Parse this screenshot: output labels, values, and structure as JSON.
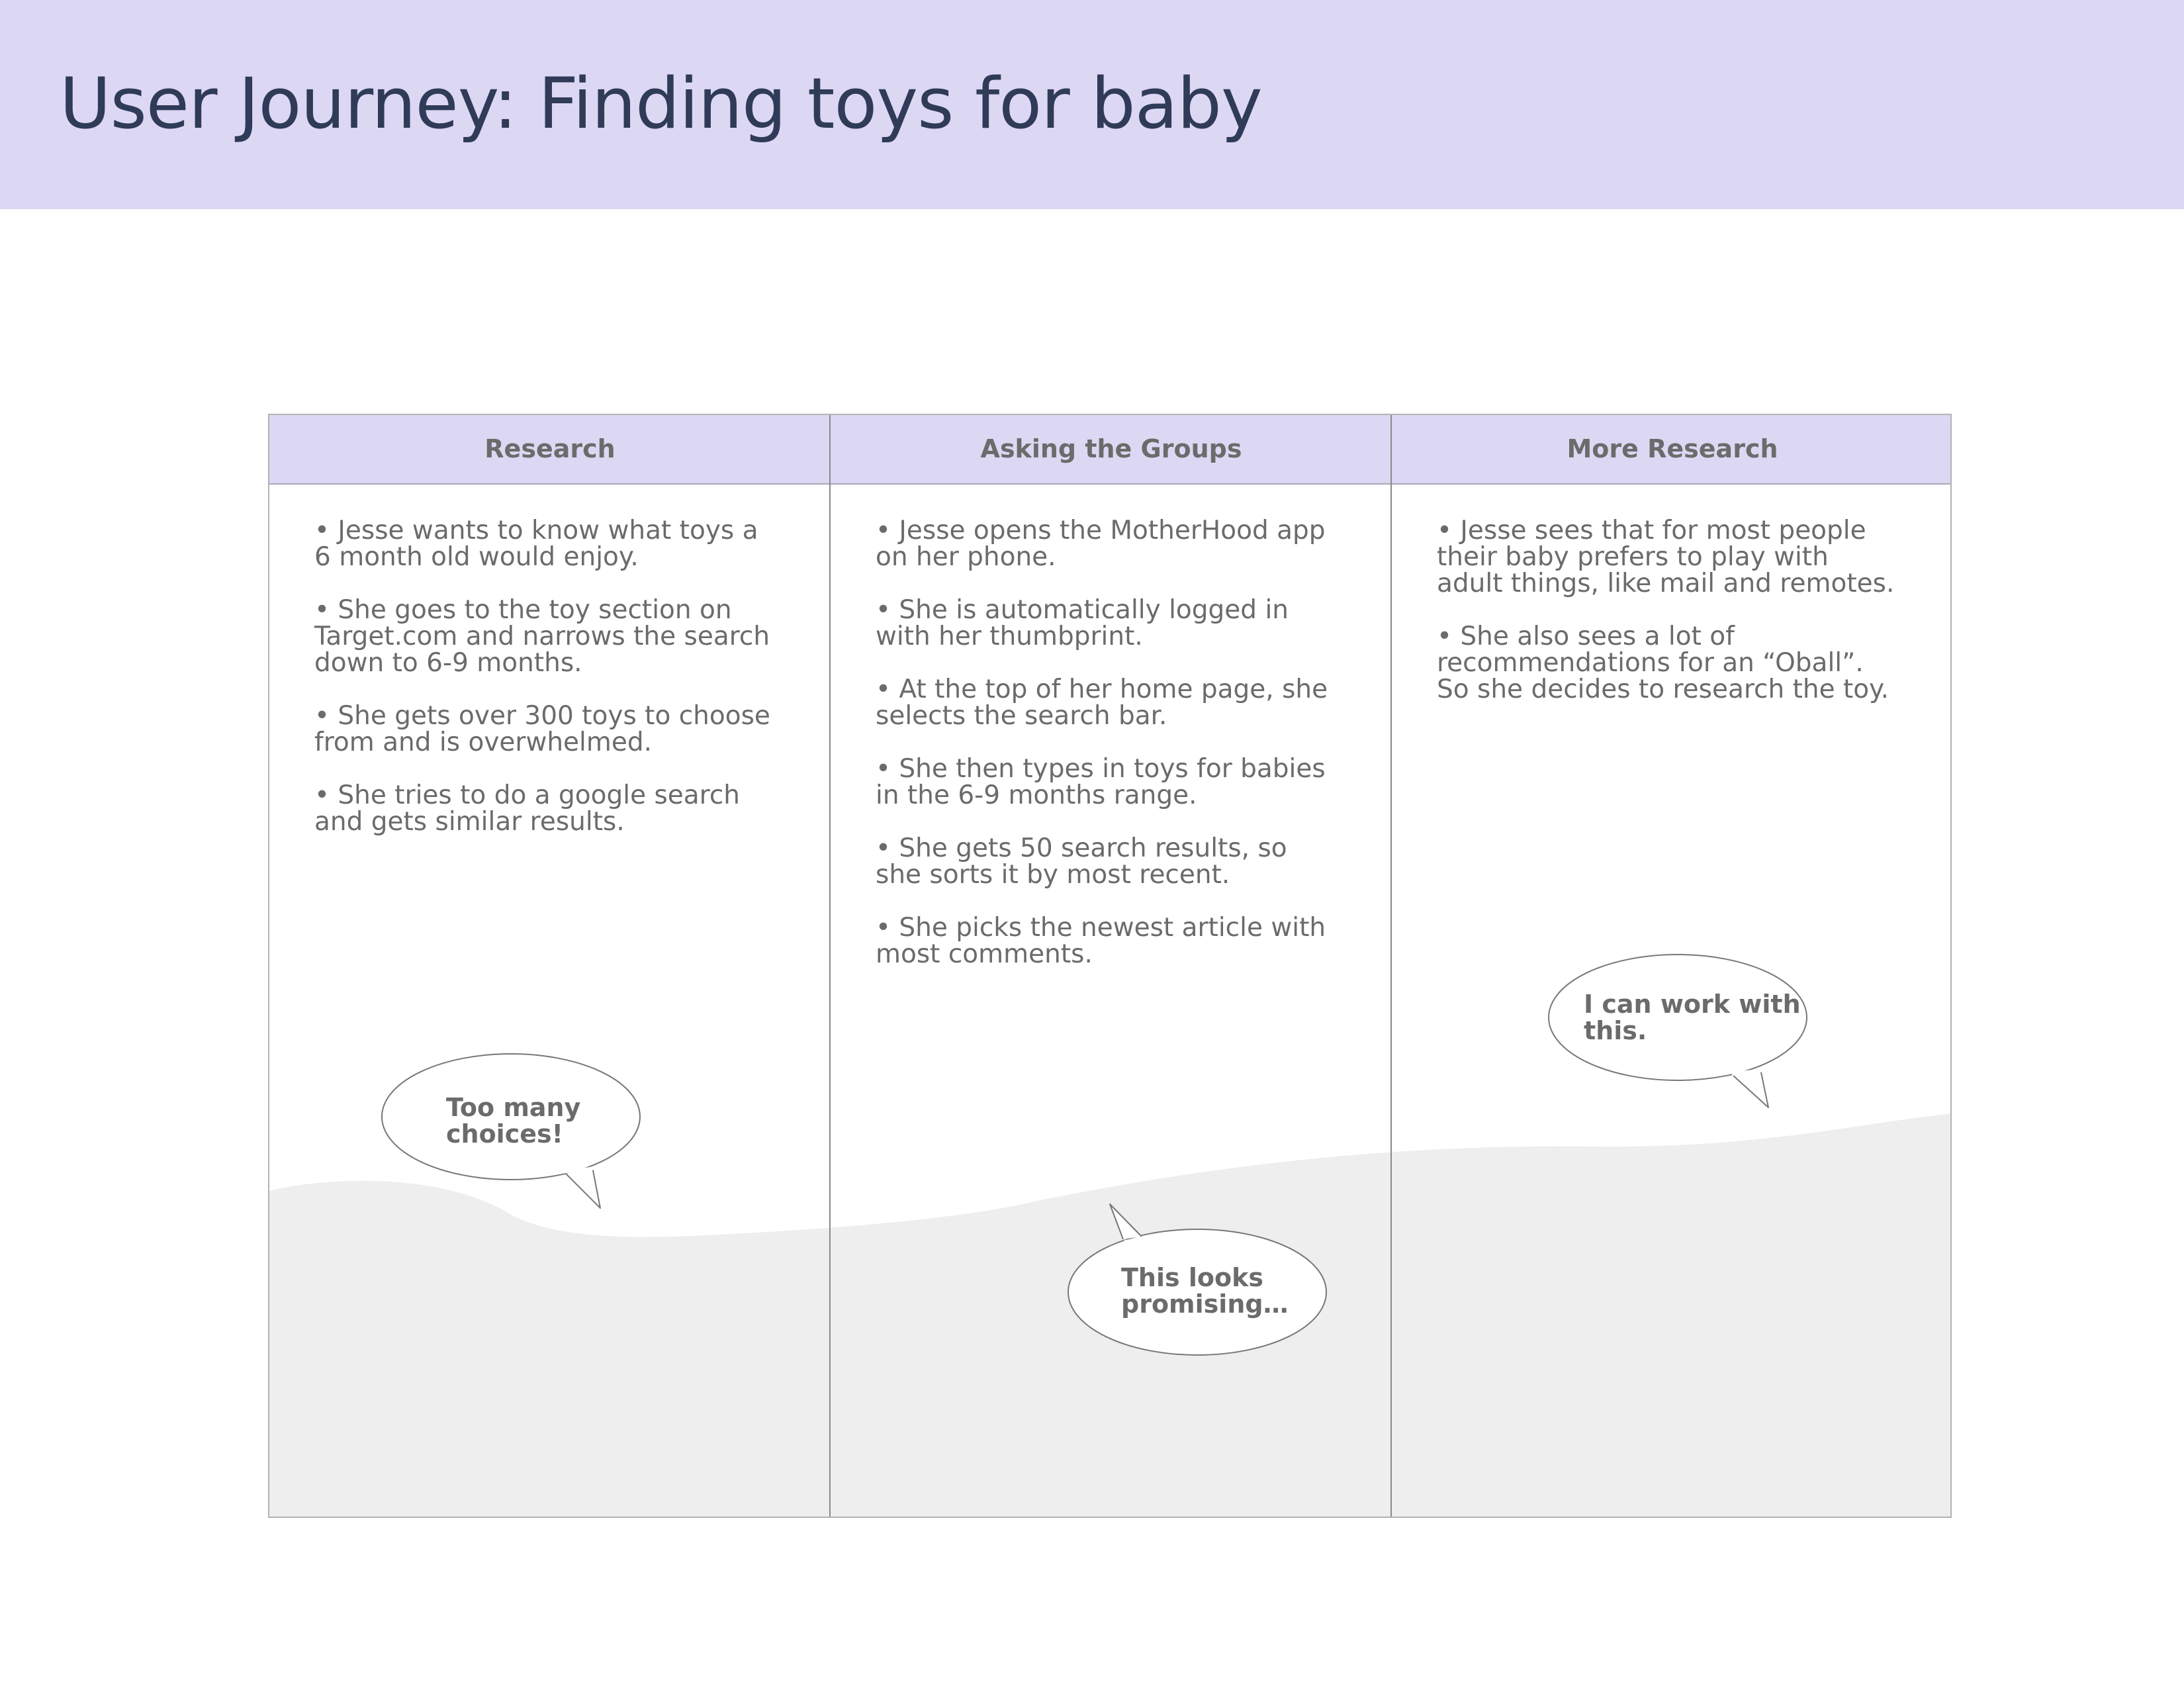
{
  "title": "User Journey: Finding toys for baby",
  "columns": [
    {
      "header": "Research",
      "bullets": [
        "Jesse wants to know what toys a 6 month old would enjoy.",
        "She goes to the toy section on Target.com and narrows the search down to 6-9 months.",
        "She gets over 300 toys to choose from and is overwhelmed.",
        "She tries to do a google search and gets similar results."
      ],
      "bubble": "Too many choices!"
    },
    {
      "header": "Asking the Groups",
      "bullets": [
        "Jesse opens the MotherHood app on her phone.",
        "She is automatically logged in with her thumbprint.",
        "At the top of her home page, she selects the search bar.",
        "She then types in toys for babies in the 6-9 months range.",
        "She gets 50 search results, so she sorts it by most recent.",
        "She picks the newest article with most comments."
      ],
      "bubble": "This looks promising…"
    },
    {
      "header": "More Research",
      "bullets": [
        "Jesse sees that for most people their baby prefers to play with adult things, like mail and remotes.",
        "She also sees a lot of recommendations for an “Oball”. So she decides to research the toy."
      ],
      "bubble": "I can work with this."
    }
  ],
  "colors": {
    "header_bg": "#dcd7f3",
    "title_text": "#2f3b57",
    "body_text": "#6b6b6b",
    "emotion_fill": "#eeeeee"
  }
}
